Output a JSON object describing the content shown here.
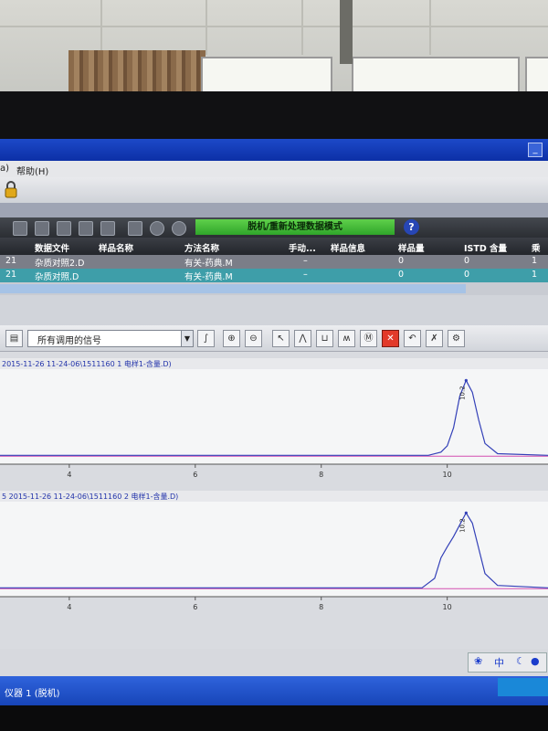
{
  "menubar": {
    "help_partial": "a)",
    "help": "帮助(H)"
  },
  "toolbar": {
    "mode_banner": "脱机/重新处理数据模式",
    "help_glyph": "?"
  },
  "table": {
    "columns": [
      "数据文件",
      "样品名称",
      "方法名称",
      "手动...",
      "样品信息",
      "样品量",
      "ISTD 含量",
      "乘积"
    ],
    "rows": [
      {
        "cut": "21",
        "file": "杂质对照2.D",
        "sample": "",
        "method": "有关-药典.M",
        "manual": "–",
        "info": "",
        "amount": "0",
        "istd": "0",
        "mult": "1"
      },
      {
        "cut": "21",
        "file": "杂质对照.D",
        "sample": "",
        "method": "有关-药典.M",
        "manual": "–",
        "info": "",
        "amount": "0",
        "istd": "0",
        "mult": "1"
      }
    ]
  },
  "signal_toolbar": {
    "signal_select": "所有调用的信号"
  },
  "chromatograms": [
    {
      "label": "2015-11-26 11-24-06\\1511160 1 电样1-含量.D)",
      "peak_label": "10.2",
      "x_ticks": [
        "4",
        "6",
        "8",
        "10"
      ]
    },
    {
      "label": "5 2015-11-26 11-24-06\\1511160 2 电样1-含量.D)",
      "peak_label": "10.2",
      "x_ticks": [
        "4",
        "6",
        "8",
        "10"
      ]
    }
  ],
  "chart_data": [
    {
      "type": "line",
      "title": "",
      "xlabel": "",
      "ylabel": "",
      "xlim": [
        2.9,
        11.6
      ],
      "ylim": [
        -2,
        100
      ],
      "series": [
        {
          "x": [
            2.9,
            9.7,
            9.9,
            10.0,
            10.1,
            10.2,
            10.3,
            10.4,
            10.5,
            10.6,
            10.8,
            11.6
          ],
          "y": [
            0,
            0,
            4,
            12,
            35,
            75,
            95,
            80,
            45,
            15,
            2,
            0
          ]
        }
      ]
    },
    {
      "type": "line",
      "title": "",
      "xlabel": "",
      "ylabel": "",
      "xlim": [
        2.9,
        11.6
      ],
      "ylim": [
        -2,
        100
      ],
      "series": [
        {
          "x": [
            2.9,
            9.6,
            9.8,
            9.9,
            10.0,
            10.1,
            10.2,
            10.3,
            10.4,
            10.5,
            10.6,
            10.8,
            11.6
          ],
          "y": [
            0,
            0,
            12,
            38,
            52,
            65,
            80,
            95,
            82,
            50,
            18,
            3,
            0
          ]
        }
      ]
    }
  ],
  "ime": {
    "lang": "中",
    "sym": "●"
  },
  "taskbar": {
    "status": "仪器 1 (脱机)"
  }
}
